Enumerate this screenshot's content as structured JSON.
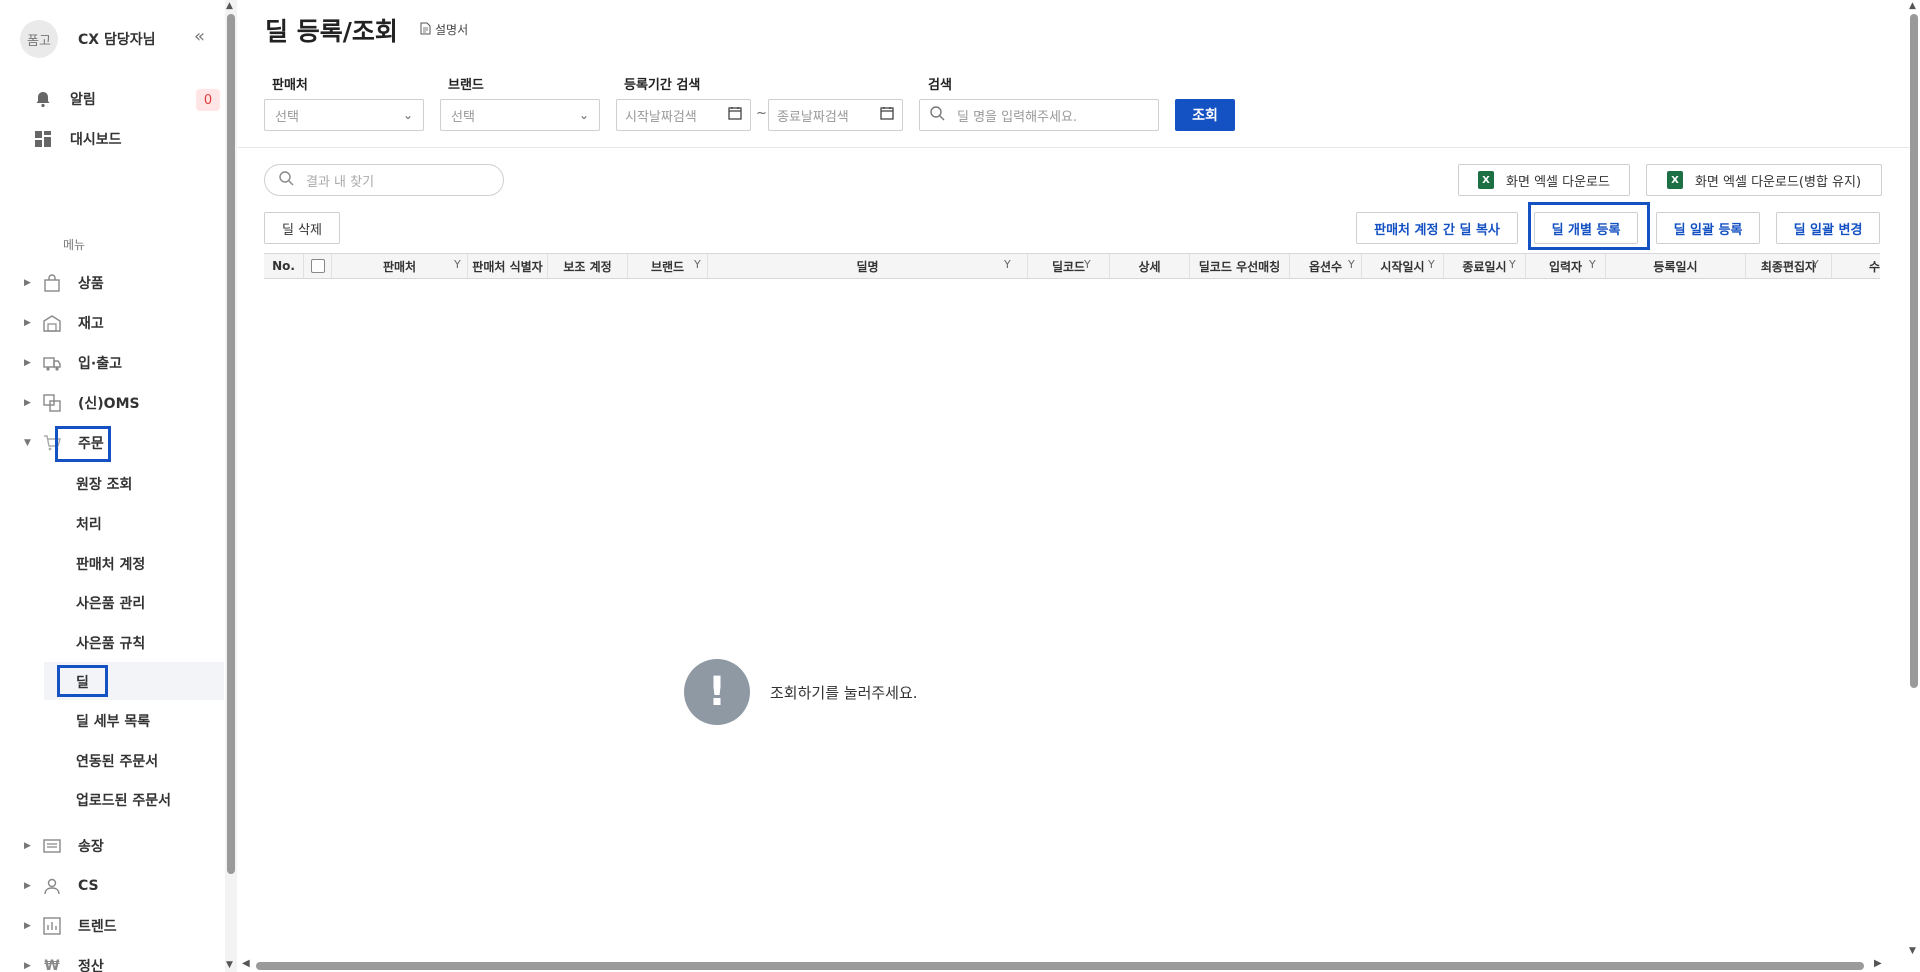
{
  "sidebar": {
    "avatar_text": "폼고",
    "profile_name": "CX 담당자님",
    "collapse_icon": "double-chevron-left-icon",
    "top_items": [
      {
        "label": "알림",
        "icon": "bell-icon",
        "badge": "0"
      },
      {
        "label": "대시보드",
        "icon": "dashboard-icon"
      }
    ],
    "menu_label": "메뉴",
    "nav": [
      {
        "label": "상품",
        "icon": "bag-icon"
      },
      {
        "label": "재고",
        "icon": "warehouse-icon"
      },
      {
        "label": "입·출고",
        "icon": "truck-icon"
      },
      {
        "label": "(신)OMS",
        "icon": "transfer-icon"
      },
      {
        "label": "주문",
        "icon": "cart-icon",
        "expanded": true
      },
      {
        "label": "송장",
        "icon": "invoice-icon"
      },
      {
        "label": "CS",
        "icon": "person-icon"
      },
      {
        "label": "트렌드",
        "icon": "chart-icon"
      },
      {
        "label": "정산",
        "icon": "won-icon"
      }
    ],
    "order_sub": [
      "원장 조회",
      "처리",
      "판매처 계정",
      "사은품 관리",
      "사은품 규칙",
      "딜",
      "딜 세부 목록",
      "연동된 주문서",
      "업로드된 주문서"
    ],
    "active_sub": "딜"
  },
  "header": {
    "title": "딜 등록/조회",
    "manual_label": "설명서",
    "manual_icon": "document-icon"
  },
  "filters": {
    "seller_label": "판매처",
    "seller_value": "선택",
    "brand_label": "브랜드",
    "brand_value": "선택",
    "period_label": "등록기간 검색",
    "start_placeholder": "시작날짜검색",
    "end_placeholder": "종료날짜검색",
    "tilde": "~",
    "search_label": "검색",
    "search_placeholder": "딜 명을 입력해주세요.",
    "search_button": "조회"
  },
  "toolbar": {
    "result_search_placeholder": "결과 내 찾기",
    "excel_download": "화면 엑셀 다운로드",
    "excel_download_merge": "화면 엑셀 다운로드(병합 유지)",
    "excel_icon_text": "X",
    "delete_deal": "딜 삭제",
    "copy_deal": "판매처 계정 간 딜 복사",
    "register_individual": "딜 개별 등록",
    "register_bulk": "딜 일괄 등록",
    "change_bulk": "딜 일괄 변경"
  },
  "grid": {
    "columns": [
      "No.",
      "",
      "판매처",
      "판매처 식별자",
      "보조 계정",
      "브랜드",
      "딜명",
      "딜코드",
      "상세",
      "딜코드 우선매칭",
      "옵션수",
      "시작일시",
      "종료일시",
      "입력자",
      "등록일시",
      "최종편집자",
      "수"
    ],
    "empty_message": "조회하기를 눌러주세요.",
    "empty_icon_text": "!"
  },
  "colors": {
    "primary": "#1451c2",
    "badge_bg": "#ffe5e5",
    "badge_text": "#e03a3a",
    "excel_green": "#1d7044",
    "empty_icon": "#8e99a3"
  }
}
